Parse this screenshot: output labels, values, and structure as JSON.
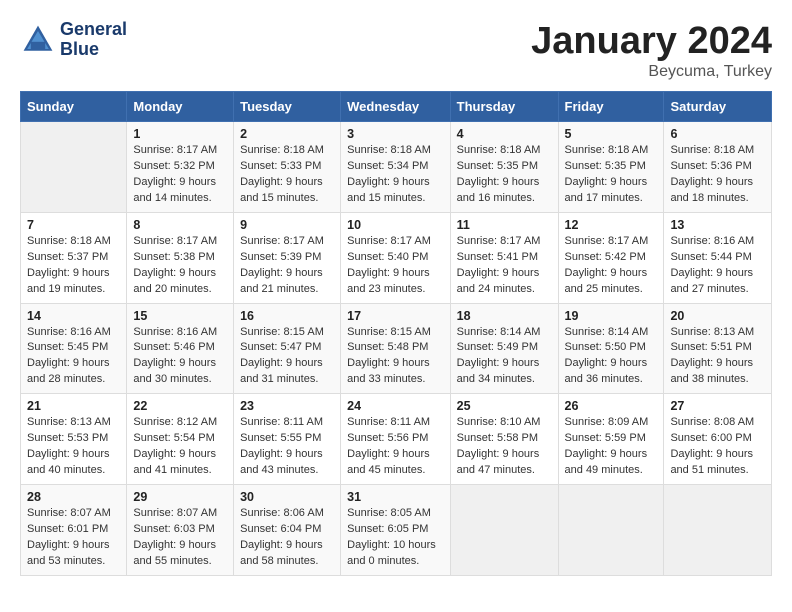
{
  "logo": {
    "line1": "General",
    "line2": "Blue"
  },
  "title": "January 2024",
  "location": "Beycuma, Turkey",
  "days_of_week": [
    "Sunday",
    "Monday",
    "Tuesday",
    "Wednesday",
    "Thursday",
    "Friday",
    "Saturday"
  ],
  "weeks": [
    [
      {
        "num": "",
        "empty": true
      },
      {
        "num": "1",
        "sunrise": "Sunrise: 8:17 AM",
        "sunset": "Sunset: 5:32 PM",
        "daylight": "Daylight: 9 hours and 14 minutes."
      },
      {
        "num": "2",
        "sunrise": "Sunrise: 8:18 AM",
        "sunset": "Sunset: 5:33 PM",
        "daylight": "Daylight: 9 hours and 15 minutes."
      },
      {
        "num": "3",
        "sunrise": "Sunrise: 8:18 AM",
        "sunset": "Sunset: 5:34 PM",
        "daylight": "Daylight: 9 hours and 15 minutes."
      },
      {
        "num": "4",
        "sunrise": "Sunrise: 8:18 AM",
        "sunset": "Sunset: 5:35 PM",
        "daylight": "Daylight: 9 hours and 16 minutes."
      },
      {
        "num": "5",
        "sunrise": "Sunrise: 8:18 AM",
        "sunset": "Sunset: 5:35 PM",
        "daylight": "Daylight: 9 hours and 17 minutes."
      },
      {
        "num": "6",
        "sunrise": "Sunrise: 8:18 AM",
        "sunset": "Sunset: 5:36 PM",
        "daylight": "Daylight: 9 hours and 18 minutes."
      }
    ],
    [
      {
        "num": "7",
        "sunrise": "Sunrise: 8:18 AM",
        "sunset": "Sunset: 5:37 PM",
        "daylight": "Daylight: 9 hours and 19 minutes."
      },
      {
        "num": "8",
        "sunrise": "Sunrise: 8:17 AM",
        "sunset": "Sunset: 5:38 PM",
        "daylight": "Daylight: 9 hours and 20 minutes."
      },
      {
        "num": "9",
        "sunrise": "Sunrise: 8:17 AM",
        "sunset": "Sunset: 5:39 PM",
        "daylight": "Daylight: 9 hours and 21 minutes."
      },
      {
        "num": "10",
        "sunrise": "Sunrise: 8:17 AM",
        "sunset": "Sunset: 5:40 PM",
        "daylight": "Daylight: 9 hours and 23 minutes."
      },
      {
        "num": "11",
        "sunrise": "Sunrise: 8:17 AM",
        "sunset": "Sunset: 5:41 PM",
        "daylight": "Daylight: 9 hours and 24 minutes."
      },
      {
        "num": "12",
        "sunrise": "Sunrise: 8:17 AM",
        "sunset": "Sunset: 5:42 PM",
        "daylight": "Daylight: 9 hours and 25 minutes."
      },
      {
        "num": "13",
        "sunrise": "Sunrise: 8:16 AM",
        "sunset": "Sunset: 5:44 PM",
        "daylight": "Daylight: 9 hours and 27 minutes."
      }
    ],
    [
      {
        "num": "14",
        "sunrise": "Sunrise: 8:16 AM",
        "sunset": "Sunset: 5:45 PM",
        "daylight": "Daylight: 9 hours and 28 minutes."
      },
      {
        "num": "15",
        "sunrise": "Sunrise: 8:16 AM",
        "sunset": "Sunset: 5:46 PM",
        "daylight": "Daylight: 9 hours and 30 minutes."
      },
      {
        "num": "16",
        "sunrise": "Sunrise: 8:15 AM",
        "sunset": "Sunset: 5:47 PM",
        "daylight": "Daylight: 9 hours and 31 minutes."
      },
      {
        "num": "17",
        "sunrise": "Sunrise: 8:15 AM",
        "sunset": "Sunset: 5:48 PM",
        "daylight": "Daylight: 9 hours and 33 minutes."
      },
      {
        "num": "18",
        "sunrise": "Sunrise: 8:14 AM",
        "sunset": "Sunset: 5:49 PM",
        "daylight": "Daylight: 9 hours and 34 minutes."
      },
      {
        "num": "19",
        "sunrise": "Sunrise: 8:14 AM",
        "sunset": "Sunset: 5:50 PM",
        "daylight": "Daylight: 9 hours and 36 minutes."
      },
      {
        "num": "20",
        "sunrise": "Sunrise: 8:13 AM",
        "sunset": "Sunset: 5:51 PM",
        "daylight": "Daylight: 9 hours and 38 minutes."
      }
    ],
    [
      {
        "num": "21",
        "sunrise": "Sunrise: 8:13 AM",
        "sunset": "Sunset: 5:53 PM",
        "daylight": "Daylight: 9 hours and 40 minutes."
      },
      {
        "num": "22",
        "sunrise": "Sunrise: 8:12 AM",
        "sunset": "Sunset: 5:54 PM",
        "daylight": "Daylight: 9 hours and 41 minutes."
      },
      {
        "num": "23",
        "sunrise": "Sunrise: 8:11 AM",
        "sunset": "Sunset: 5:55 PM",
        "daylight": "Daylight: 9 hours and 43 minutes."
      },
      {
        "num": "24",
        "sunrise": "Sunrise: 8:11 AM",
        "sunset": "Sunset: 5:56 PM",
        "daylight": "Daylight: 9 hours and 45 minutes."
      },
      {
        "num": "25",
        "sunrise": "Sunrise: 8:10 AM",
        "sunset": "Sunset: 5:58 PM",
        "daylight": "Daylight: 9 hours and 47 minutes."
      },
      {
        "num": "26",
        "sunrise": "Sunrise: 8:09 AM",
        "sunset": "Sunset: 5:59 PM",
        "daylight": "Daylight: 9 hours and 49 minutes."
      },
      {
        "num": "27",
        "sunrise": "Sunrise: 8:08 AM",
        "sunset": "Sunset: 6:00 PM",
        "daylight": "Daylight: 9 hours and 51 minutes."
      }
    ],
    [
      {
        "num": "28",
        "sunrise": "Sunrise: 8:07 AM",
        "sunset": "Sunset: 6:01 PM",
        "daylight": "Daylight: 9 hours and 53 minutes."
      },
      {
        "num": "29",
        "sunrise": "Sunrise: 8:07 AM",
        "sunset": "Sunset: 6:03 PM",
        "daylight": "Daylight: 9 hours and 55 minutes."
      },
      {
        "num": "30",
        "sunrise": "Sunrise: 8:06 AM",
        "sunset": "Sunset: 6:04 PM",
        "daylight": "Daylight: 9 hours and 58 minutes."
      },
      {
        "num": "31",
        "sunrise": "Sunrise: 8:05 AM",
        "sunset": "Sunset: 6:05 PM",
        "daylight": "Daylight: 10 hours and 0 minutes."
      },
      {
        "num": "",
        "empty": true
      },
      {
        "num": "",
        "empty": true
      },
      {
        "num": "",
        "empty": true
      }
    ]
  ]
}
